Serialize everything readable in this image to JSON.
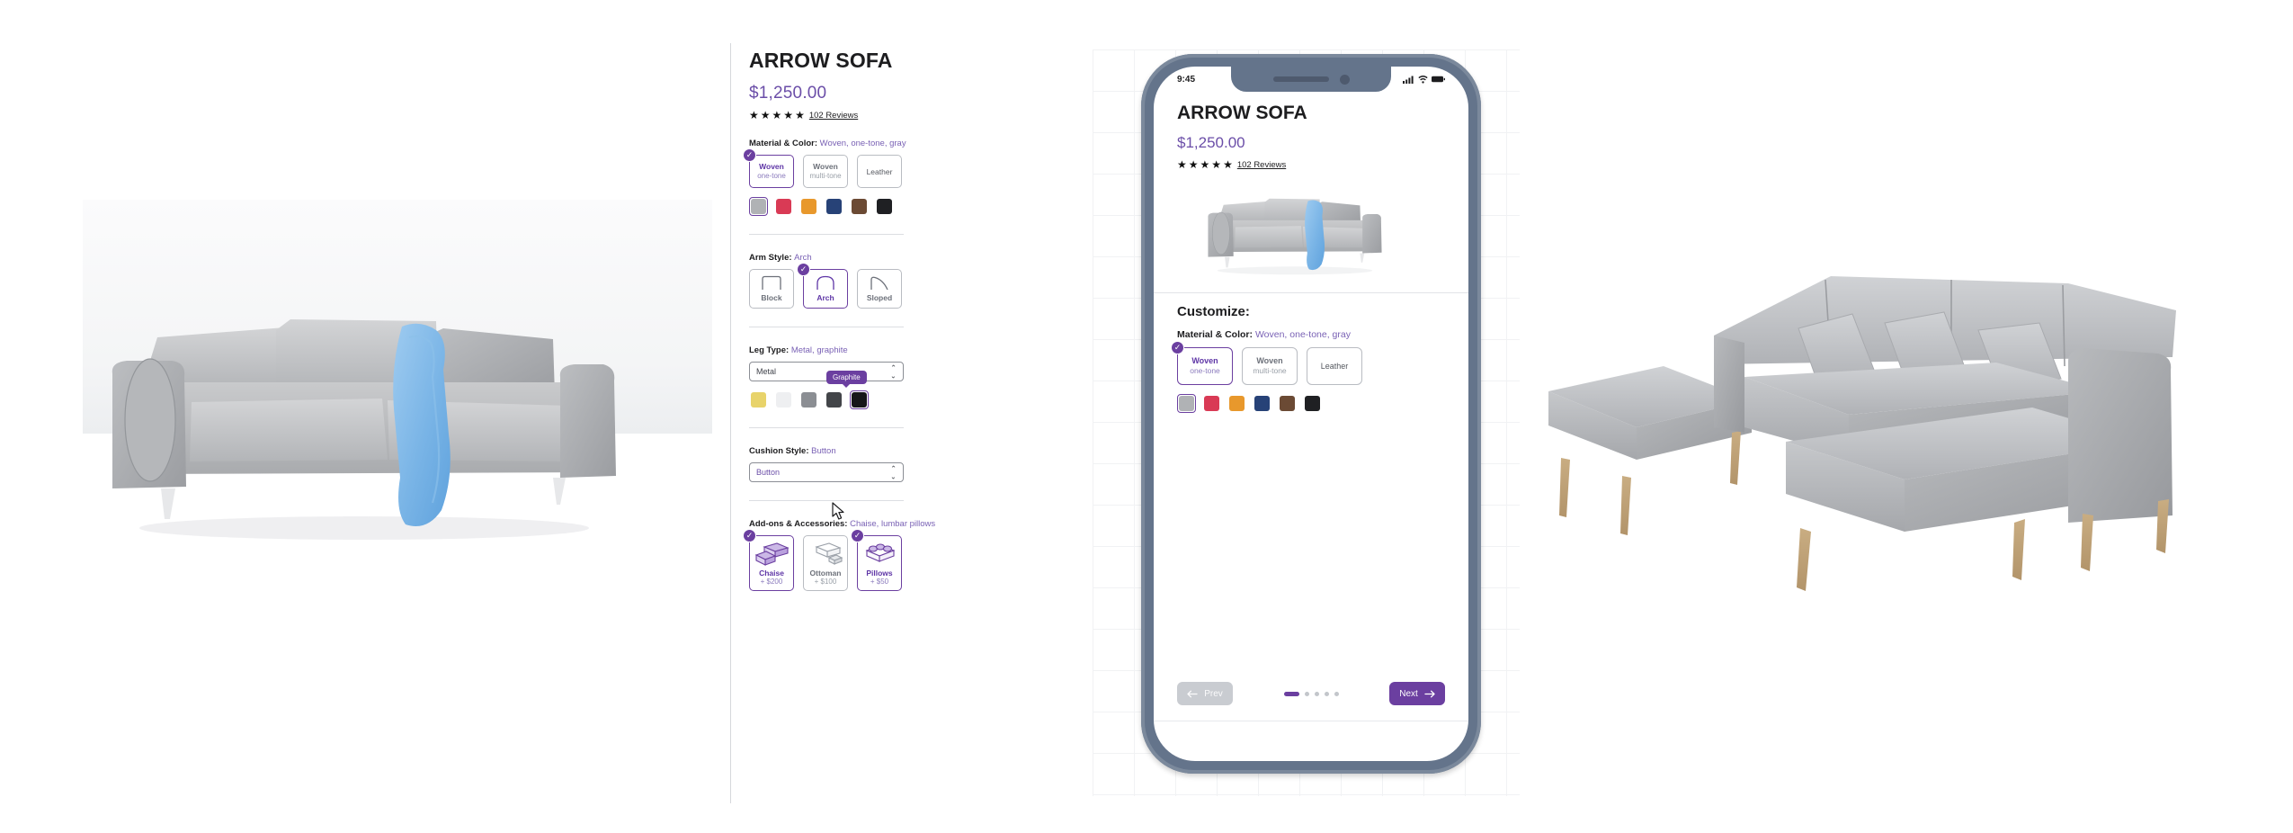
{
  "product": {
    "title": "ARROW SOFA",
    "price": "$1,250.00",
    "reviews_label": "102 Reviews",
    "star_glyph": "★",
    "star_count": 5
  },
  "accent": {
    "purple": "#6b3fa0",
    "purple_text": "#6b4ea8",
    "muted_purple": "#7a62b5",
    "border_gray": "#b9bcc2"
  },
  "sections": {
    "material": {
      "label": "Material & Color:",
      "value": "Woven, one-tone, gray",
      "options": [
        {
          "line1": "Woven",
          "line2": "one-tone",
          "selected": true
        },
        {
          "line1": "Woven",
          "line2": "multi-tone",
          "selected": false
        },
        {
          "line1": "Leather",
          "line2": "",
          "selected": false
        }
      ],
      "swatches": [
        {
          "name": "gray",
          "hex": "#b0b2b5",
          "selected": true
        },
        {
          "name": "crimson",
          "hex": "#d93a55",
          "selected": false
        },
        {
          "name": "orange",
          "hex": "#e8982c",
          "selected": false
        },
        {
          "name": "navy",
          "hex": "#274277",
          "selected": false
        },
        {
          "name": "brown",
          "hex": "#6b4a34",
          "selected": false
        },
        {
          "name": "black",
          "hex": "#1f2023",
          "selected": false
        }
      ]
    },
    "arm_style": {
      "label": "Arm Style:",
      "value": "Arch",
      "options": [
        {
          "line1": "Block",
          "selected": false,
          "icon": "arm-block-icon"
        },
        {
          "line1": "Arch",
          "selected": true,
          "icon": "arm-arch-icon"
        },
        {
          "line1": "Sloped",
          "selected": false,
          "icon": "arm-sloped-icon"
        }
      ]
    },
    "leg_type": {
      "label": "Leg Type:",
      "value": "Metal, graphite",
      "select_value": "Metal",
      "tooltip": "Graphite",
      "swatches": [
        {
          "name": "gold",
          "hex": "#e8d36a",
          "selected": false
        },
        {
          "name": "white",
          "hex": "#eeeff1",
          "selected": false
        },
        {
          "name": "mid-gray",
          "hex": "#8b8e93",
          "selected": false
        },
        {
          "name": "dark-gray",
          "hex": "#434549",
          "selected": false
        },
        {
          "name": "graphite",
          "hex": "#16171a",
          "selected": true
        }
      ]
    },
    "cushion_style": {
      "label": "Cushion Style:",
      "value": "Button",
      "select_value": "Button"
    },
    "addons": {
      "label": "Add-ons & Accessories:",
      "value": "Chaise, lumbar pillows",
      "options": [
        {
          "name": "Chaise",
          "price": "+ $200",
          "selected": true,
          "icon": "sofa-chaise-icon"
        },
        {
          "name": "Ottoman",
          "price": "+ $100",
          "selected": false,
          "icon": "sofa-ottoman-icon"
        },
        {
          "name": "Pillows",
          "price": "+ $50",
          "selected": true,
          "icon": "sofa-pillows-icon"
        }
      ]
    }
  },
  "phone": {
    "status": {
      "time": "9:45"
    },
    "customize_heading": "Customize:",
    "nav": {
      "prev_label": "Prev",
      "next_label": "Next",
      "dots_total": 5,
      "dots_active_index": 0
    }
  }
}
